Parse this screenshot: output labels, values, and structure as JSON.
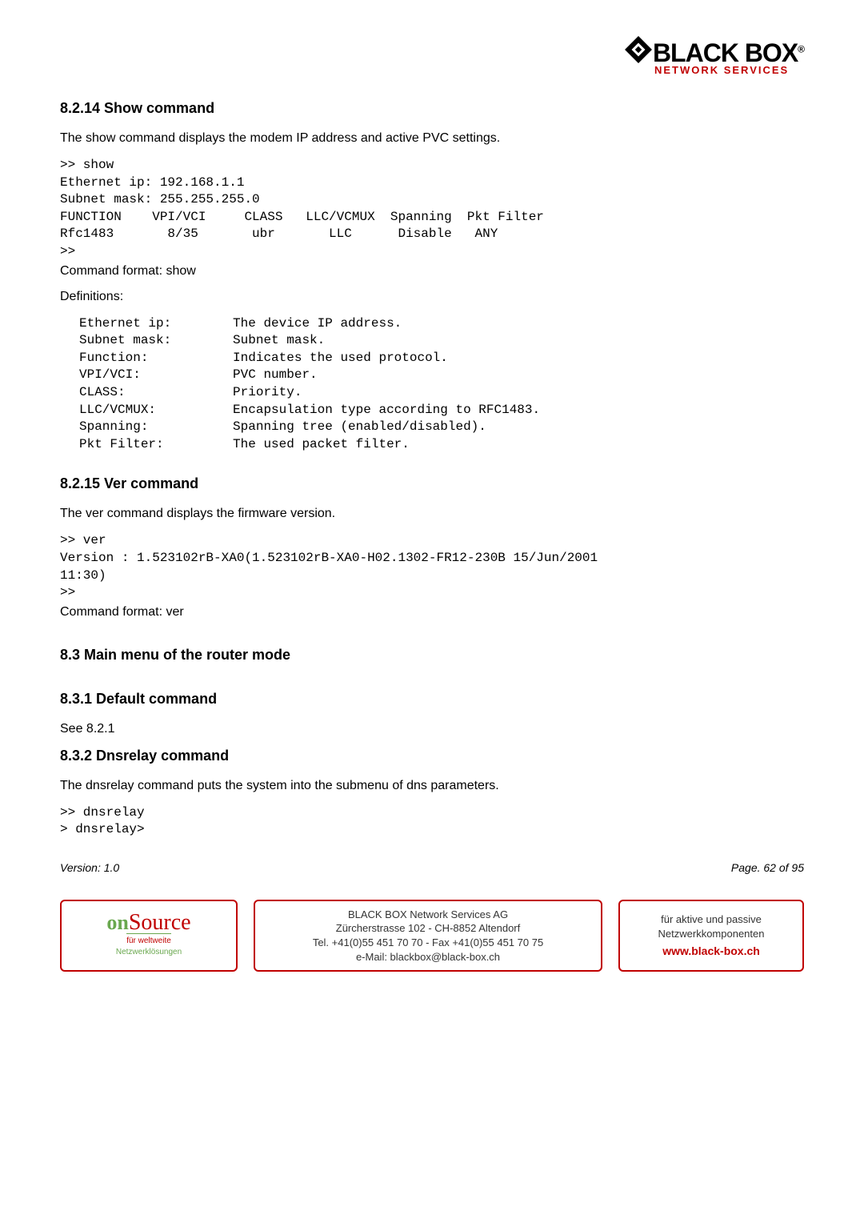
{
  "logo": {
    "main": "BLACK BOX",
    "sub": "NETWORK SERVICES",
    "r": "®"
  },
  "s1": {
    "heading": "8.2.14 Show command",
    "intro": "The show command displays the modem IP address and active PVC settings.",
    "code": ">> show\nEthernet ip: 192.168.1.1\nSubnet mask: 255.255.255.0\nFUNCTION    VPI/VCI     CLASS   LLC/VCMUX  Spanning  Pkt Filter\nRfc1483       8/35       ubr       LLC      Disable   ANY\n>>",
    "cmdfmt": "Command format: show",
    "defs_label": "Definitions:",
    "defs": [
      {
        "k": "Ethernet ip:",
        "v": "The device IP address."
      },
      {
        "k": "Subnet mask:",
        "v": "Subnet mask."
      },
      {
        "k": "Function:",
        "v": "Indicates the used protocol."
      },
      {
        "k": "VPI/VCI:",
        "v": "PVC number."
      },
      {
        "k": "CLASS:",
        "v": "Priority."
      },
      {
        "k": "LLC/VCMUX:",
        "v": "Encapsulation type according to RFC1483."
      },
      {
        "k": "Spanning:",
        "v": "Spanning tree (enabled/disabled)."
      },
      {
        "k": "Pkt Filter:",
        "v": "The used packet filter."
      }
    ]
  },
  "s2": {
    "heading": "8.2.15 Ver command",
    "intro": "The ver command displays the firmware version.",
    "code": ">> ver\nVersion : 1.523102rB-XA0(1.523102rB-XA0-H02.1302-FR12-230B 15/Jun/2001\n11:30)\n>>",
    "cmdfmt": "Command format: ver"
  },
  "s3": {
    "heading": "8.3    Main menu of the router mode"
  },
  "s4": {
    "heading": "8.3.1  Default command",
    "body": "See 8.2.1"
  },
  "s5": {
    "heading": "8.3.2  Dnsrelay command",
    "intro": "The dnsrelay command puts the system into the submenu of dns parameters.",
    "code": ">> dnsrelay\n> dnsrelay>"
  },
  "version": {
    "left": "Version: 1.0",
    "right": "Page. 62 of 95"
  },
  "footer": {
    "left": {
      "brand_on": "on",
      "brand_rest": "Source",
      "line1": "für weltweite",
      "line2": "Netzwerklösungen"
    },
    "mid": {
      "l1": "BLACK BOX Network Services AG",
      "l2": "Zürcherstrasse 102 - CH-8852 Altendorf",
      "l3": "Tel. +41(0)55 451 70 70 - Fax +41(0)55 451 70 75",
      "l4": "e-Mail: blackbox@black-box.ch"
    },
    "right": {
      "l1": "für  aktive und passive",
      "l2": "Netzwerkkomponenten",
      "l3": "www.black-box.ch"
    }
  }
}
